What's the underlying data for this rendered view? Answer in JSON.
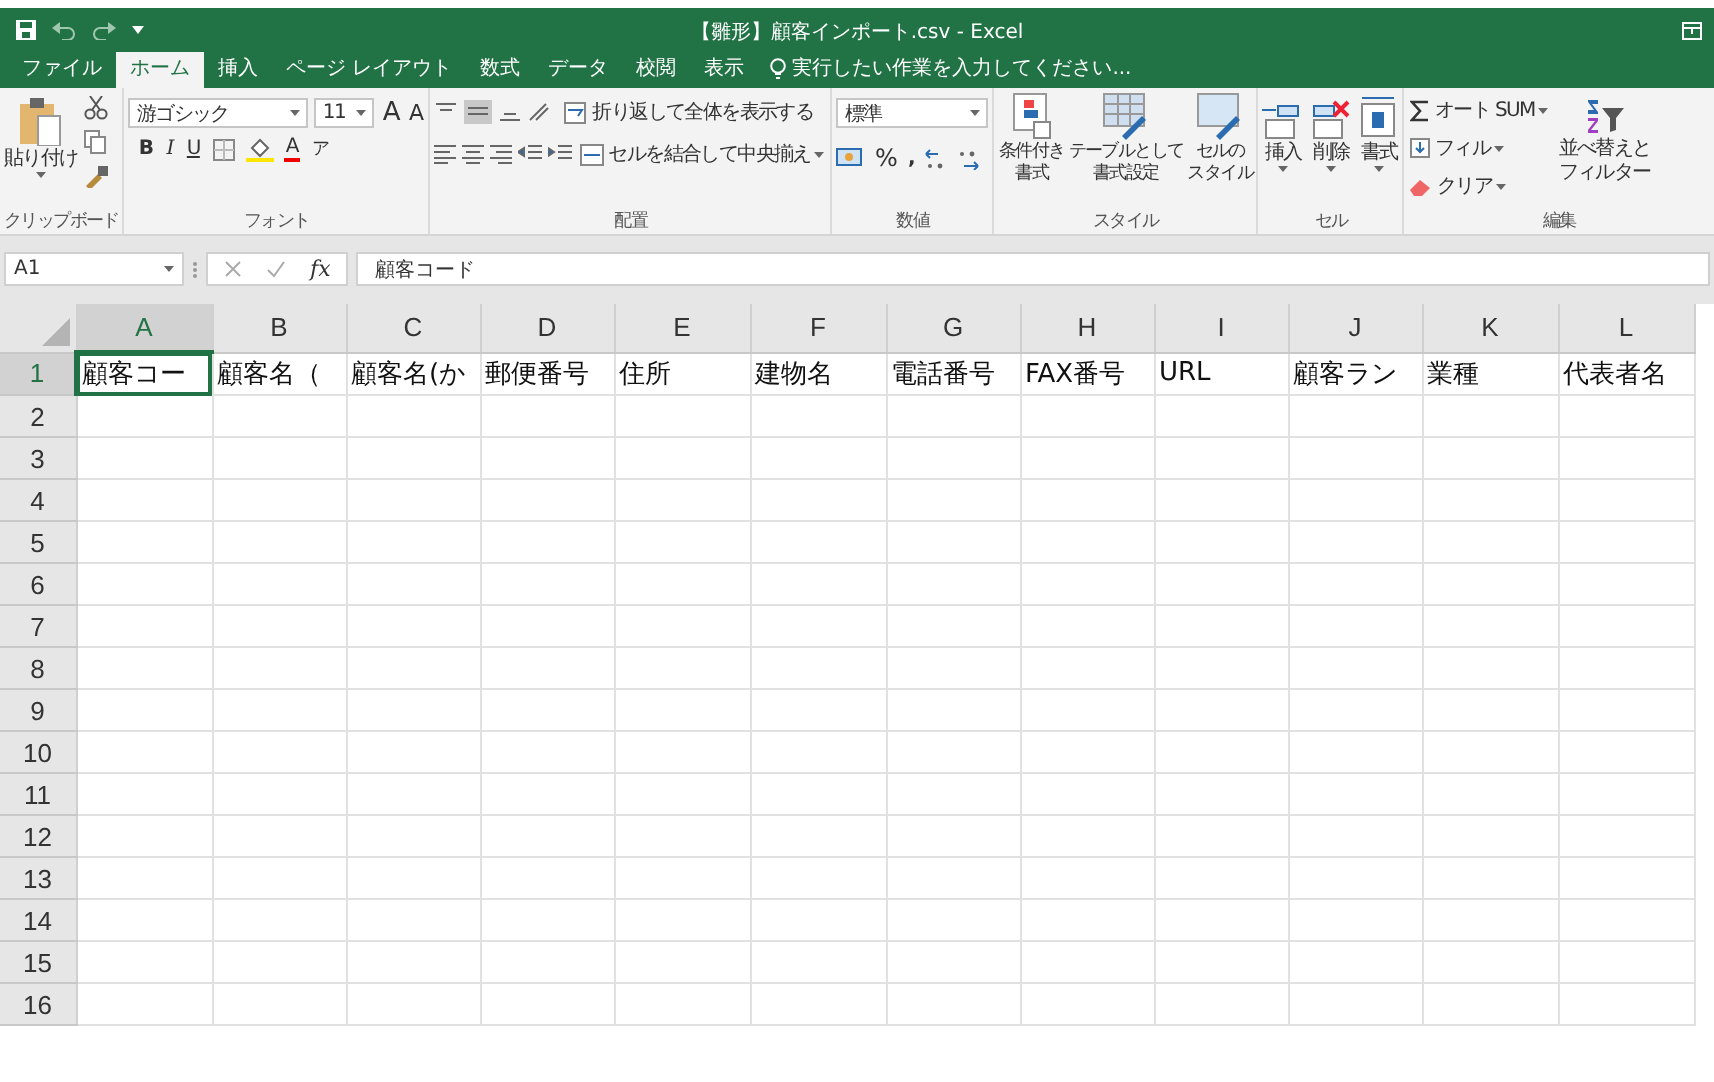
{
  "title_bar": {
    "title": "【雛形】顧客インポート.csv - Excel"
  },
  "menu_tabs": [
    {
      "label": "ファイル",
      "selected": false
    },
    {
      "label": "ホーム",
      "selected": true
    },
    {
      "label": "挿入",
      "selected": false
    },
    {
      "label": "ページ レイアウト",
      "selected": false
    },
    {
      "label": "数式",
      "selected": false
    },
    {
      "label": "データ",
      "selected": false
    },
    {
      "label": "校閲",
      "selected": false
    },
    {
      "label": "表示",
      "selected": false
    }
  ],
  "tell_me": {
    "placeholder": "実行したい作業を入力してください..."
  },
  "ribbon": {
    "clipboard": {
      "label": "クリップボード",
      "paste": "貼り付け"
    },
    "font": {
      "label": "フォント",
      "font_name": "游ゴシック",
      "font_size": "11",
      "grow": "A",
      "shrink": "A",
      "styles": [
        {
          "kind": "bold",
          "label": "B"
        },
        {
          "kind": "italic",
          "label": "I"
        },
        {
          "kind": "underline",
          "label": "U"
        }
      ],
      "font_color": "A",
      "phonetic": "ア"
    },
    "alignment": {
      "label": "配置",
      "wrap": "折り返して全体を表示する",
      "merge": "セルを結合して中央揃え"
    },
    "number": {
      "label": "数値",
      "format": "標準",
      "percent": "%",
      "comma": ","
    },
    "styles": {
      "label": "スタイル",
      "buttons": [
        {
          "kind": "conditional",
          "lines": [
            "条件付き",
            "書式"
          ]
        },
        {
          "kind": "table",
          "lines": [
            "テーブルとして",
            "書式設定"
          ]
        },
        {
          "kind": "cell",
          "lines": [
            "セルの",
            "スタイル"
          ]
        }
      ]
    },
    "cells": {
      "label": "セル",
      "buttons": [
        {
          "kind": "insert",
          "label": "挿入"
        },
        {
          "kind": "delete",
          "label": "削除"
        },
        {
          "kind": "format",
          "label": "書式"
        }
      ]
    },
    "editing": {
      "label": "編集",
      "autosum": "オート SUM",
      "fill": "フィル",
      "clear": "クリア",
      "sort_lines": [
        "並べ替えと",
        "フィルター"
      ]
    }
  },
  "formula_bar": {
    "name_box": "A1",
    "fx": "fx",
    "formula": "顧客コード"
  },
  "sheet": {
    "columns": [
      {
        "label": "A",
        "selected": true
      },
      {
        "label": "B",
        "selected": false
      },
      {
        "label": "C",
        "selected": false
      },
      {
        "label": "D",
        "selected": false
      },
      {
        "label": "E",
        "selected": false
      },
      {
        "label": "F",
        "selected": false
      },
      {
        "label": "G",
        "selected": false
      },
      {
        "label": "H",
        "selected": false
      },
      {
        "label": "I",
        "selected": false
      },
      {
        "label": "J",
        "selected": false
      },
      {
        "label": "K",
        "selected": false
      },
      {
        "label": "L",
        "selected": false
      }
    ],
    "rows": [
      {
        "label": "1",
        "selected": true,
        "cells": [
          "顧客コー",
          "顧客名（",
          "顧客名(か",
          "郵便番号",
          "住所",
          "建物名",
          "電話番号",
          "FAX番号",
          "URL",
          "顧客ラン",
          "業種",
          "代表者名"
        ]
      },
      {
        "label": "2",
        "selected": false
      },
      {
        "label": "3",
        "selected": false
      },
      {
        "label": "4",
        "selected": false
      },
      {
        "label": "5",
        "selected": false
      },
      {
        "label": "6",
        "selected": false
      },
      {
        "label": "7",
        "selected": false
      },
      {
        "label": "8",
        "selected": false
      },
      {
        "label": "9",
        "selected": false
      },
      {
        "label": "10",
        "selected": false
      },
      {
        "label": "11",
        "selected": false
      },
      {
        "label": "12",
        "selected": false
      },
      {
        "label": "13",
        "selected": false
      },
      {
        "label": "14",
        "selected": false
      },
      {
        "label": "15",
        "selected": false
      },
      {
        "label": "16",
        "selected": false
      }
    ]
  }
}
